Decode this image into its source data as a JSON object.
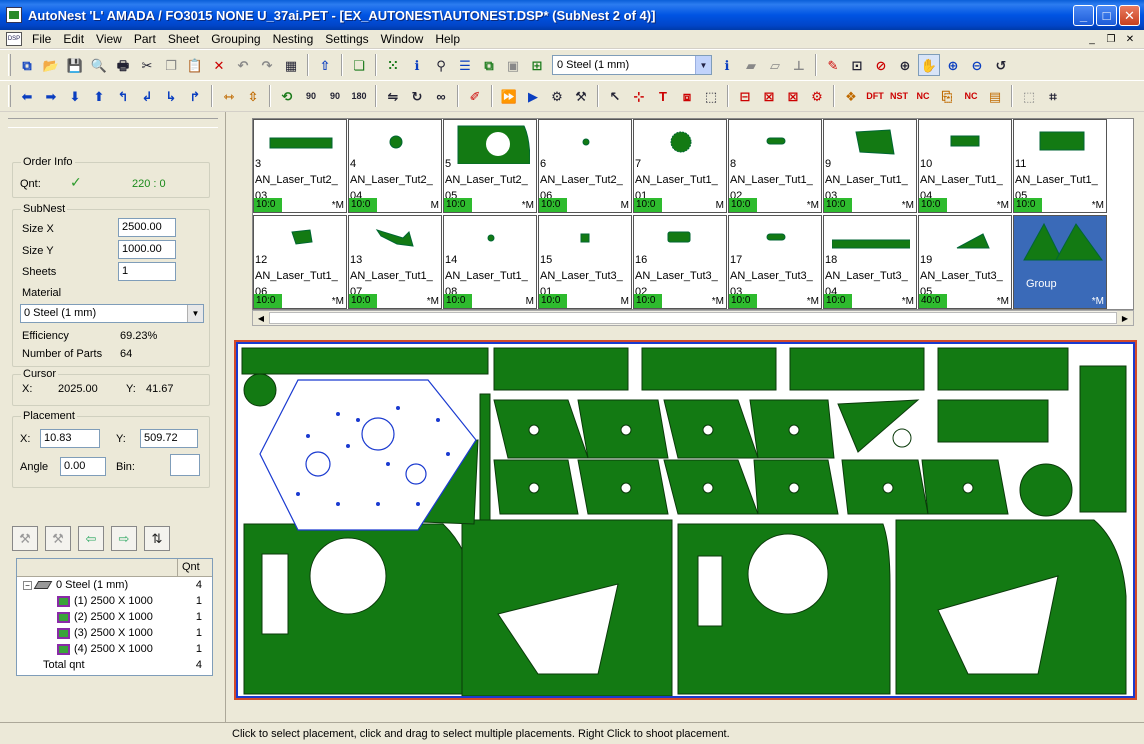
{
  "window": {
    "title": "AutoNest  'L'  AMADA / FO3015    NONE  U_37ai.PET - [EX_AUTONEST\\AUTONEST.DSP* (SubNest 2 of 4)]",
    "minimize": "_",
    "maximize": "□",
    "close": "✕"
  },
  "menu": {
    "items": [
      "File",
      "Edit",
      "View",
      "Part",
      "Sheet",
      "Grouping",
      "Nesting",
      "Settings",
      "Window",
      "Help"
    ],
    "mdi_min": "_",
    "mdi_restore": "❐",
    "mdi_close": "✕"
  },
  "toolbar": {
    "material_value": "0   Steel  (1 mm)",
    "angle_labels": [
      "90",
      "90",
      "180"
    ],
    "badges": [
      "DFT",
      "NST",
      "NC",
      "NC"
    ]
  },
  "left_panel": {
    "order_info": {
      "title": "Order Info",
      "qnt_label": "Qnt:",
      "qnt_value": "220 : 0"
    },
    "subnest": {
      "title": "SubNest",
      "size_x_label": "Size X",
      "size_x": "2500.00",
      "size_y_label": "Size Y",
      "size_y": "1000.00",
      "sheets_label": "Sheets",
      "sheets": "1",
      "material_label": "Material",
      "material": "0   Steel  (1 mm)",
      "efficiency_label": "Efficiency",
      "efficiency": "69.23%",
      "num_parts_label": "Number of Parts",
      "num_parts": "64"
    },
    "cursor": {
      "title": "Cursor",
      "x_label": "X:",
      "x": "2025.00",
      "y_label": "Y:",
      "y": "41.67"
    },
    "placement": {
      "title": "Placement",
      "x_label": "X:",
      "x": "10.83",
      "y_label": "Y:",
      "y": "509.72",
      "angle_label": "Angle",
      "angle": "0.00",
      "bin_label": "Bin:",
      "bin": ""
    },
    "tree": {
      "col_qnt": "Qnt",
      "root_label": "0   Steel  (1 mm)",
      "root_qnt": "4",
      "sheets": [
        {
          "label": "(1) 2500 X 1000",
          "qnt": "1"
        },
        {
          "label": "(2) 2500 X 1000",
          "qnt": "1"
        },
        {
          "label": "(3) 2500 X 1000",
          "qnt": "1"
        },
        {
          "label": "(4) 2500 X 1000",
          "qnt": "1"
        }
      ],
      "total_label": "Total qnt",
      "total_qnt": "4"
    }
  },
  "parts": [
    {
      "num": "3",
      "name": "AN_Laser_Tut2_",
      "sub": "03",
      "qty": "10:0",
      "flag": "*M",
      "shape": "bar"
    },
    {
      "num": "4",
      "name": "AN_Laser_Tut2_",
      "sub": "04",
      "qty": "10:0",
      "flag": "M",
      "shape": "gear-small"
    },
    {
      "num": "5",
      "name": "AN_Laser_Tut2_",
      "sub": "05",
      "qty": "10:0",
      "flag": "*M",
      "shape": "big-plate"
    },
    {
      "num": "6",
      "name": "AN_Laser_Tut2_",
      "sub": "06",
      "qty": "10:0",
      "flag": "M",
      "shape": "dot"
    },
    {
      "num": "7",
      "name": "AN_Laser_Tut1_",
      "sub": "01",
      "qty": "10:0",
      "flag": "M",
      "shape": "gear"
    },
    {
      "num": "8",
      "name": "AN_Laser_Tut1_",
      "sub": "02",
      "qty": "10:0",
      "flag": "*M",
      "shape": "slot"
    },
    {
      "num": "9",
      "name": "AN_Laser_Tut1_",
      "sub": "03",
      "qty": "10:0",
      "flag": "*M",
      "shape": "quad"
    },
    {
      "num": "10",
      "name": "AN_Laser_Tut1_",
      "sub": "04",
      "qty": "10:0",
      "flag": "*M",
      "shape": "bracket"
    },
    {
      "num": "11",
      "name": "AN_Laser_Tut1_",
      "sub": "05",
      "qty": "10:0",
      "flag": "*M",
      "shape": "rect"
    },
    {
      "num": "12",
      "name": "AN_Laser_Tut1_",
      "sub": "06",
      "qty": "10:0",
      "flag": "*M",
      "shape": "tab"
    },
    {
      "num": "13",
      "name": "AN_Laser_Tut1_",
      "sub": "07",
      "qty": "10:0",
      "flag": "*M",
      "shape": "zig"
    },
    {
      "num": "14",
      "name": "AN_Laser_Tut1_",
      "sub": "08",
      "qty": "10:0",
      "flag": "M",
      "shape": "dot"
    },
    {
      "num": "15",
      "name": "AN_Laser_Tut3_",
      "sub": "01",
      "qty": "10:0",
      "flag": "M",
      "shape": "square-small"
    },
    {
      "num": "16",
      "name": "AN_Laser_Tut3_",
      "sub": "02",
      "qty": "10:0",
      "flag": "*M",
      "shape": "rect-small"
    },
    {
      "num": "17",
      "name": "AN_Laser_Tut3_",
      "sub": "03",
      "qty": "10:0",
      "flag": "*M",
      "shape": "slot"
    },
    {
      "num": "18",
      "name": "AN_Laser_Tut3_",
      "sub": "04",
      "qty": "10:0",
      "flag": "*M",
      "shape": "long-bar"
    },
    {
      "num": "19",
      "name": "AN_Laser_Tut3_",
      "sub": "05",
      "qty": "40:0",
      "flag": "*M",
      "shape": "triangle"
    },
    {
      "num": "",
      "name": "Group",
      "sub": "",
      "qty": "",
      "flag": "*M",
      "shape": "group"
    }
  ],
  "status": "Click to select placement, click and drag to select multiple placements. Right Click to shoot placement.",
  "colors": {
    "part_green": "#137a13",
    "qty_green": "#2ebb2e",
    "sheet_border": "#1a3ad0",
    "sheet_outline": "#d24a2a",
    "selected_blue": "#3a6ab8"
  }
}
